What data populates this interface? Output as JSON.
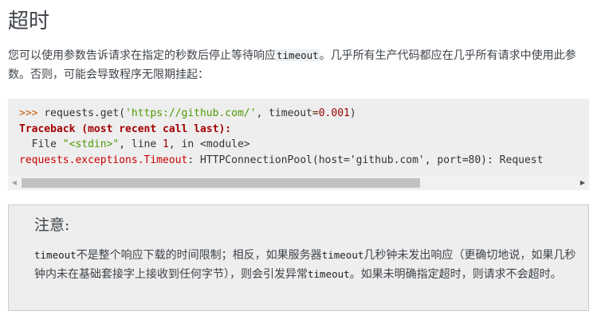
{
  "heading": "超时",
  "intro": {
    "before": "您可以使用参数告诉请求在指定的秒数后停止等待响应",
    "code": "timeout",
    "after": "。几乎所有生产代码都应在几乎所有请求中使用此参数。否则，可能会导致程序无限期挂起："
  },
  "code_block": {
    "line1": {
      "prompt": ">>> ",
      "call": "requests.get(",
      "url": "'https://github.com/'",
      "sep": ", timeout",
      "eq": "=",
      "num": "0.001",
      "close": ")"
    },
    "line2": "Traceback (most recent call last):",
    "line3": {
      "a": "  File ",
      "b": "\"<stdin>\"",
      "c": ", line ",
      "d": "1",
      "e": ", in <module>"
    },
    "line4": {
      "exc": "requests.exceptions.Timeout",
      "colon": ": ",
      "rest": "HTTPConnectionPool(host='github.com', port=80): Request"
    }
  },
  "scrollbar": {
    "left_arrow": "◀",
    "right_arrow": "▶",
    "visible_fraction": 0.72
  },
  "note": {
    "title": "注意:",
    "code1": "timeout",
    "text1": "不是整个响应下载的时间限制；相反，如果服务器",
    "code2": "timeout",
    "text2": "几秒钟未发出响应（更确切地说，如果几秒钟内未在基础套接字上接收到任何字节），则会引发异常",
    "code3": "timeout",
    "text3": "。如果未明确指定超时，则请求不会超时。"
  }
}
